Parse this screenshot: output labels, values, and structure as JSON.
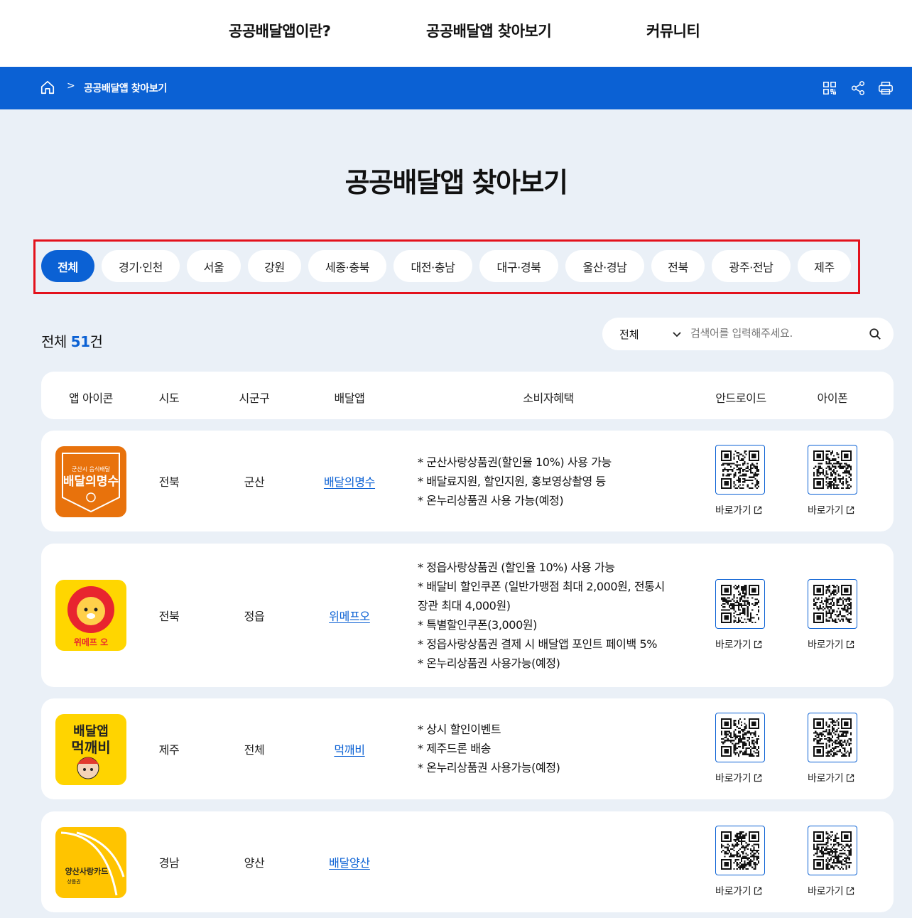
{
  "nav": {
    "items": [
      "공공배달앱이란?",
      "공공배달앱 찾아보기",
      "커뮤니티"
    ]
  },
  "breadcrumb": {
    "separator": ">",
    "current": "공공배달앱 찾아보기",
    "icons": [
      "home-icon",
      "qr-code-icon",
      "share-icon",
      "print-icon"
    ]
  },
  "page": {
    "title": "공공배달앱 찾아보기"
  },
  "filters": {
    "chips": [
      "전체",
      "경기·인천",
      "서울",
      "강원",
      "세종·충북",
      "대전·충남",
      "대구·경북",
      "울산·경남",
      "전북",
      "광주·전남",
      "제주"
    ],
    "active": "전체"
  },
  "count": {
    "prefix": "전체",
    "number": "51",
    "suffix": "건"
  },
  "search": {
    "select_value": "전체",
    "placeholder": "검색어를 입력해주세요."
  },
  "table": {
    "headers": [
      "앱 아이콘",
      "시도",
      "시군구",
      "배달앱",
      "소비자혜택",
      "안드로이드",
      "아이폰"
    ],
    "link_label": "바로가기",
    "rows": [
      {
        "region": "전북",
        "city": "군산",
        "app": "배달의명수",
        "icon_text_small": "군산시 음식배달",
        "icon_text_main": "배달의명수",
        "benefits": [
          "* 군산사랑상품권(할인율 10%) 사용 가능",
          "* 배달료지원, 할인지원, 홍보영상촬영 등",
          "* 온누리상품권 사용 가능(예정)"
        ]
      },
      {
        "region": "전북",
        "city": "정읍",
        "app": "위메프오",
        "icon_text_main": "위메프 오",
        "benefits": [
          "* 정읍사랑상품권 (할인율 10%) 사용 가능",
          "* 배달비 할인쿠폰 (일반가맹점 최대 2,000원, 전통시",
          "장관 최대 4,000원)",
          "* 특별할인쿠폰(3,000원)",
          "* 정읍사랑상품권 결제 시 배달앱 포인트 페이백 5%",
          "* 온누리상품권 사용가능(예정)"
        ]
      },
      {
        "region": "제주",
        "city": "전체",
        "app": "먹깨비",
        "icon_text_small": "배달앱",
        "icon_text_main": "먹깨비",
        "benefits": [
          "* 상시 할인이벤트",
          "* 제주드론 배송",
          "* 온누리상품권 사용가능(예정)"
        ]
      },
      {
        "region": "경남",
        "city": "양산",
        "app": "배달양산",
        "icon_text_main": "양산사랑카드",
        "icon_text_small": "상품권",
        "benefits": []
      }
    ]
  },
  "colors": {
    "primary": "#0b61d4",
    "background": "#eaf0f7",
    "highlight_border": "#e3111c"
  }
}
